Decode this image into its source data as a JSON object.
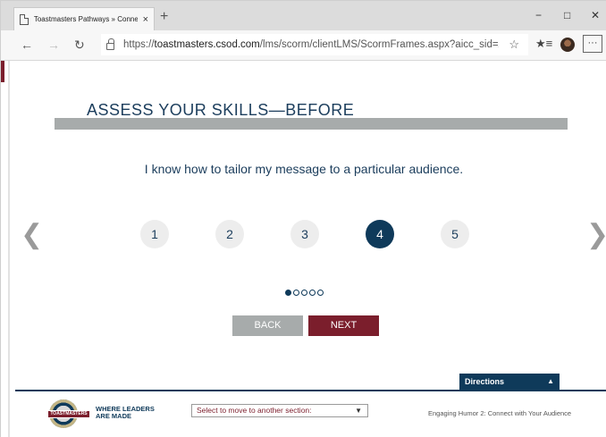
{
  "browser": {
    "tab_title": "Toastmasters Pathways » Conne",
    "tab_close": "×",
    "new_tab": "+",
    "minimize": "−",
    "maximize": "□",
    "close": "✕",
    "back": "←",
    "forward": "→",
    "refresh": "↻",
    "url_prefix": "https://",
    "url_host": "toastmasters.csod.com",
    "url_path": "/lms/scorm/clientLMS/ScormFrames.aspx?aicc_sid=AICCsKb...",
    "favorite_star": "☆",
    "favorites": "★≡",
    "more": "···"
  },
  "page": {
    "heading": "ASSESS YOUR SKILLS—BEFORE",
    "question": "I know how to tailor my message to a particular audience.",
    "prev_arrow": "❮",
    "next_arrow": "❯",
    "ratings": [
      "1",
      "2",
      "3",
      "4",
      "5"
    ],
    "selected_rating": "4",
    "pager": {
      "total": 5,
      "current": 1
    },
    "back_label": "BACK",
    "next_label": "NEXT",
    "directions_label": "Directions",
    "directions_caret": "▲"
  },
  "footer": {
    "logo_text": "TOASTMASTERS",
    "tagline": "WHERE LEADERS ARE MADE",
    "section_select": "Select to move to another section:",
    "select_caret": "▼",
    "course_title": "Engaging Humor 2: Connect with Your Audience"
  },
  "colors": {
    "navy": "#0f3a5a",
    "maroon": "#7b1e2c",
    "gray": "#a7abab"
  }
}
